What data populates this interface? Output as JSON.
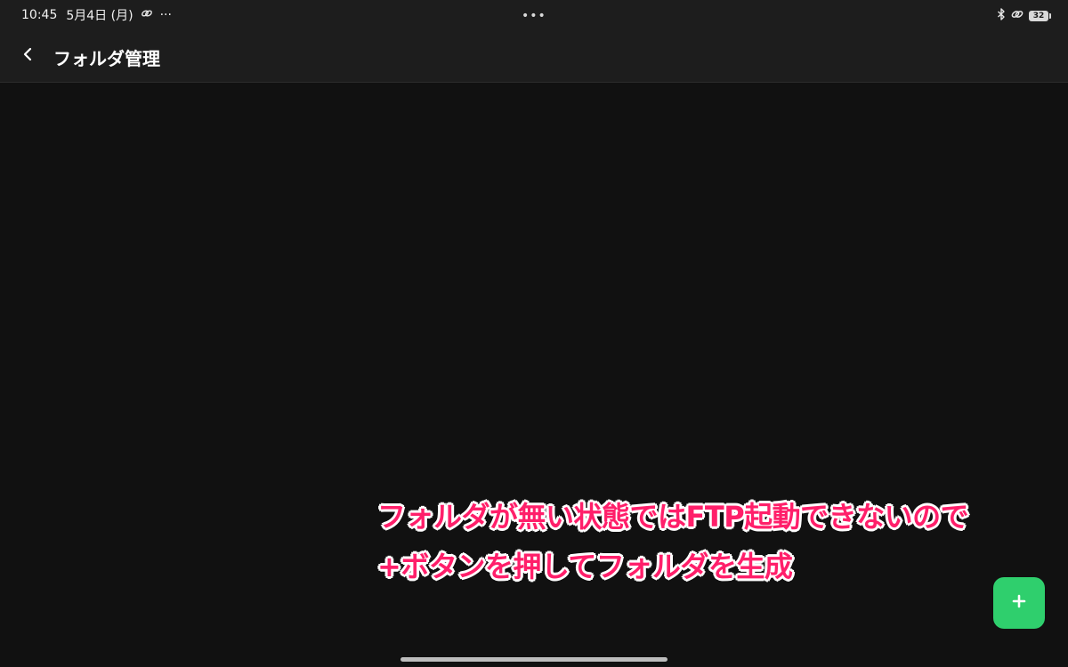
{
  "status_bar": {
    "time": "10:45",
    "date": "5月4日 (月)",
    "more": "···",
    "center_dots": "•••",
    "battery": "32",
    "icons": [
      "link-icon",
      "bluetooth-icon",
      "link-icon",
      "battery-icon"
    ]
  },
  "app_bar": {
    "back_icon": "chevron-left-icon",
    "title": "フォルダ管理"
  },
  "annotation": {
    "line1": "フォルダが無い状態ではFTP起動できないので",
    "line2": "+ボタンを押してフォルダを生成",
    "color": "#ff1f6a"
  },
  "fab": {
    "icon": "plus-icon",
    "color": "#2fcf6d"
  }
}
